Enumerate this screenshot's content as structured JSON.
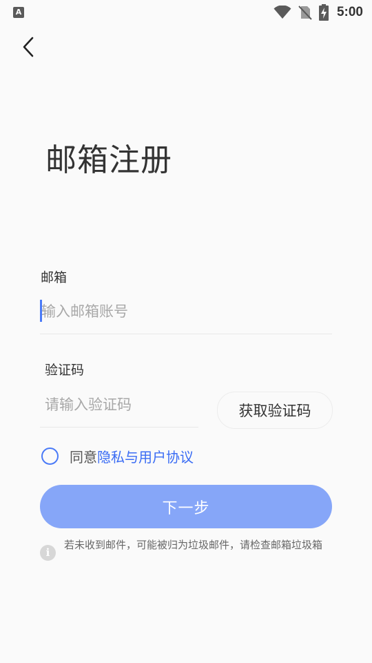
{
  "status_bar": {
    "app_icon_letter": "A",
    "time": "5:00"
  },
  "header": {
    "title": "邮箱注册"
  },
  "form": {
    "email_label": "邮箱",
    "email_placeholder": "输入邮箱账号",
    "email_value": "",
    "code_label": "验证码",
    "code_placeholder": "请输入验证码",
    "code_value": "",
    "get_code_label": "获取验证码"
  },
  "agreement": {
    "prefix": "同意",
    "link": "隐私与用户协议",
    "checked": false
  },
  "next_button_label": "下一步",
  "tip": {
    "icon_glyph": "i",
    "text": "若未收到邮件，可能被归为垃圾邮件，请检查邮箱垃圾箱"
  },
  "colors": {
    "accent": "#4a7af7",
    "link": "#3a6cf4",
    "button": "#86a6f8",
    "background": "#fafafa"
  }
}
